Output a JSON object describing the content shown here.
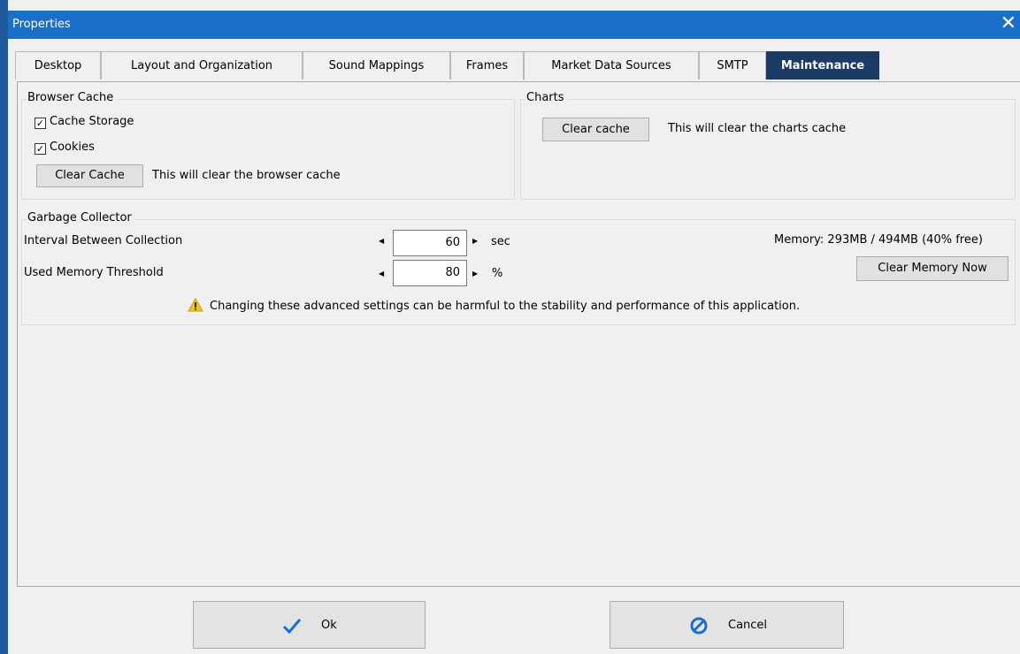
{
  "window": {
    "title": "Properties",
    "close_glyph": "✕"
  },
  "tabs": [
    {
      "label": "Desktop"
    },
    {
      "label": "Layout and Organization"
    },
    {
      "label": "Sound Mappings"
    },
    {
      "label": "Frames"
    },
    {
      "label": "Market Data Sources"
    },
    {
      "label": "SMTP"
    },
    {
      "label": "Maintenance",
      "active": true
    }
  ],
  "browser_cache": {
    "title": "Browser Cache",
    "cache_storage": {
      "label": "Cache Storage",
      "checked": true
    },
    "cookies": {
      "label": "Cookies",
      "checked": true
    },
    "clear_label": "Clear Cache",
    "description": "This will clear the browser cache"
  },
  "charts": {
    "title": "Charts",
    "clear_label": "Clear cache",
    "description": "This will clear the charts cache"
  },
  "gc": {
    "title": "Garbage Collector",
    "interval": {
      "label": "Interval Between Collection",
      "value": "60",
      "unit": "sec"
    },
    "threshold": {
      "label": "Used Memory Threshold",
      "value": "80",
      "unit": "%"
    },
    "memory": "Memory: 293MB / 494MB (40% free)",
    "clear_memory_label": "Clear Memory Now",
    "warning": "Changing these advanced settings can be harmful to the stability and performance of this application."
  },
  "footer": {
    "ok_label": "Ok",
    "cancel_label": "Cancel"
  },
  "colors": {
    "titlebar": "#1a70c9",
    "active_tab": "#1c3a66",
    "ok_icon": "#1a70c9",
    "cancel_icon": "#1a70c9",
    "warning_icon": "#f5c518"
  }
}
